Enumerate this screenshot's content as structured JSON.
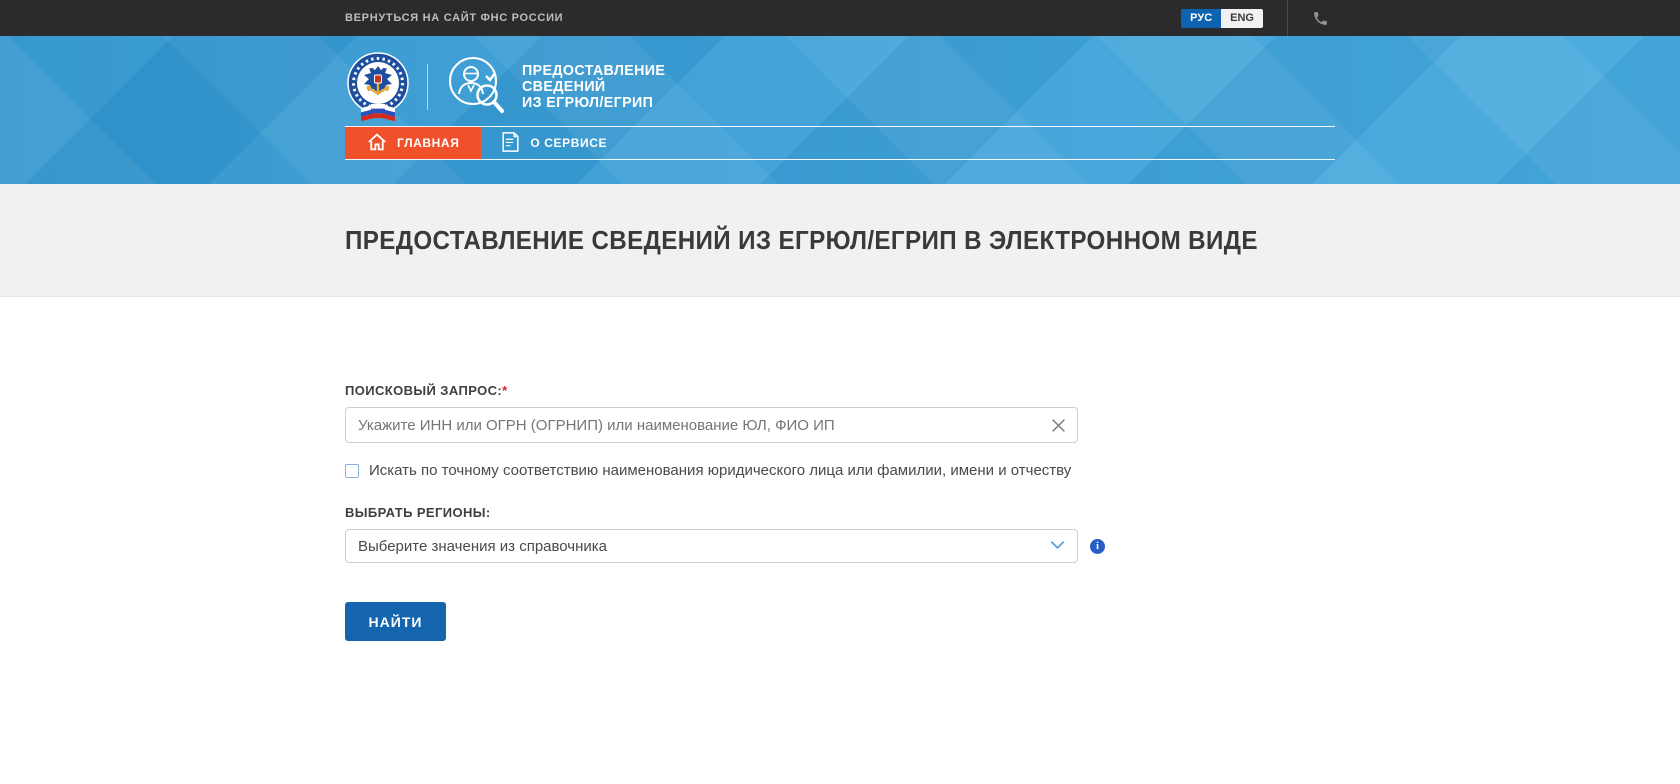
{
  "topbar": {
    "back_link": "ВЕРНУТЬСЯ НА САЙТ ФНС РОССИИ",
    "lang": {
      "rus": "РУС",
      "eng": "ENG",
      "selected": "РУС"
    },
    "phone_icon": "phone-handset"
  },
  "header": {
    "emblem_icon": "fns-russia-emblem",
    "service_icon": "magnifier-person",
    "service_title_lines": [
      "ПРЕДОСТАВЛЕНИЕ",
      "СВЕДЕНИЙ",
      "ИЗ ЕГРЮЛ/ЕГРИП"
    ],
    "nav": [
      {
        "label": "ГЛАВНАЯ",
        "icon": "home",
        "active": true
      },
      {
        "label": "О СЕРВИСЕ",
        "icon": "document",
        "active": false
      }
    ]
  },
  "page": {
    "title": "ПРЕДОСТАВЛЕНИЕ СВЕДЕНИЙ ИЗ ЕГРЮЛ/ЕГРИП В ЭЛЕКТРОННОМ ВИДЕ"
  },
  "search_form": {
    "query_label": "ПОИСКОВЫЙ ЗАПРОС:",
    "required_mark": "*",
    "query_value": "",
    "query_placeholder": "Укажите ИНН или ОГРН (ОГРНИП) или наименование ЮЛ, ФИО ИП",
    "clear_icon": "close-x",
    "exact_match_label": "Искать по точному соответствию наименования юридического лица или фамилии, имени и отчеству",
    "exact_match_checked": false,
    "regions_label": "ВЫБРАТЬ РЕГИОНЫ:",
    "regions_placeholder": "Выберите значения из справочника",
    "regions_chevron_icon": "chevron-down",
    "regions_info_icon": "info",
    "info_glyph": "i",
    "submit_label": "НАЙТИ"
  },
  "colors": {
    "topbar_bg": "#2b2b2d",
    "header_blue": "#3c9fd6",
    "accent_orange": "#f0512b",
    "lang_active_blue": "#0d63b0",
    "button_blue": "#1465ad",
    "info_blue": "#2a5ec4",
    "title_band_bg": "#f1f1f1",
    "required_red": "#e31e24"
  }
}
